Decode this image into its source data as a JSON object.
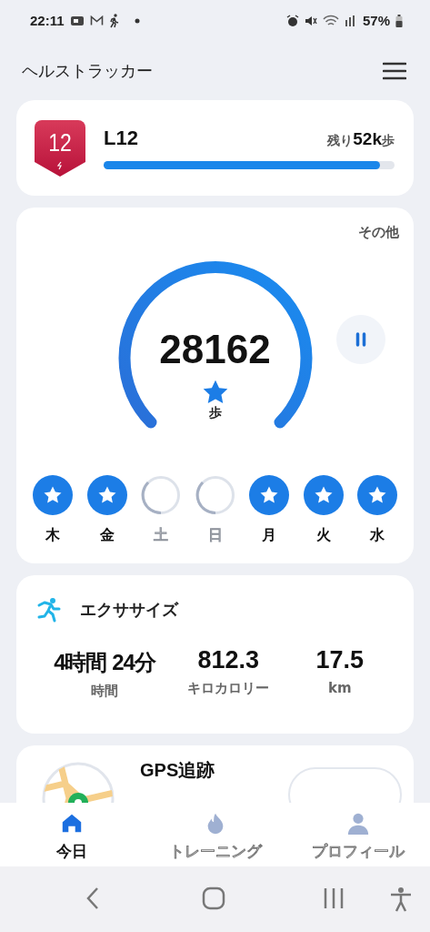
{
  "status_bar": {
    "time": "22:11",
    "battery": "57%"
  },
  "app_bar": {
    "title": "ヘルストラッカー"
  },
  "level_card": {
    "badge": "12",
    "level": "L12",
    "remaining": "残り**52k**歩",
    "progress": {
      "level": 0.95
    }
  },
  "steps_card": {
    "more": "その他",
    "count": "28162",
    "unit": "歩",
    "days": [
      {
        "label": "木",
        "done": true
      },
      {
        "label": "金",
        "done": true
      },
      {
        "label": "土",
        "done": false
      },
      {
        "label": "日",
        "done": false
      },
      {
        "label": "月",
        "done": true
      },
      {
        "label": "火",
        "done": true
      },
      {
        "label": "水",
        "done": true
      }
    ]
  },
  "exercise": {
    "title": "エクササイズ",
    "stats": [
      {
        "value": "4時間 24分",
        "label": "時間"
      },
      {
        "value": "812.3",
        "label": "キロカロリー"
      },
      {
        "value": "17.5",
        "label": "km"
      }
    ]
  },
  "gps": {
    "title": "GPS追跡"
  },
  "bottom_nav": [
    {
      "label": "今日",
      "kind": "home",
      "selected": true
    },
    {
      "label": "トレーニング",
      "kind": "flame",
      "selected": false
    },
    {
      "label": "プロフィール",
      "kind": "person",
      "selected": false
    }
  ]
}
